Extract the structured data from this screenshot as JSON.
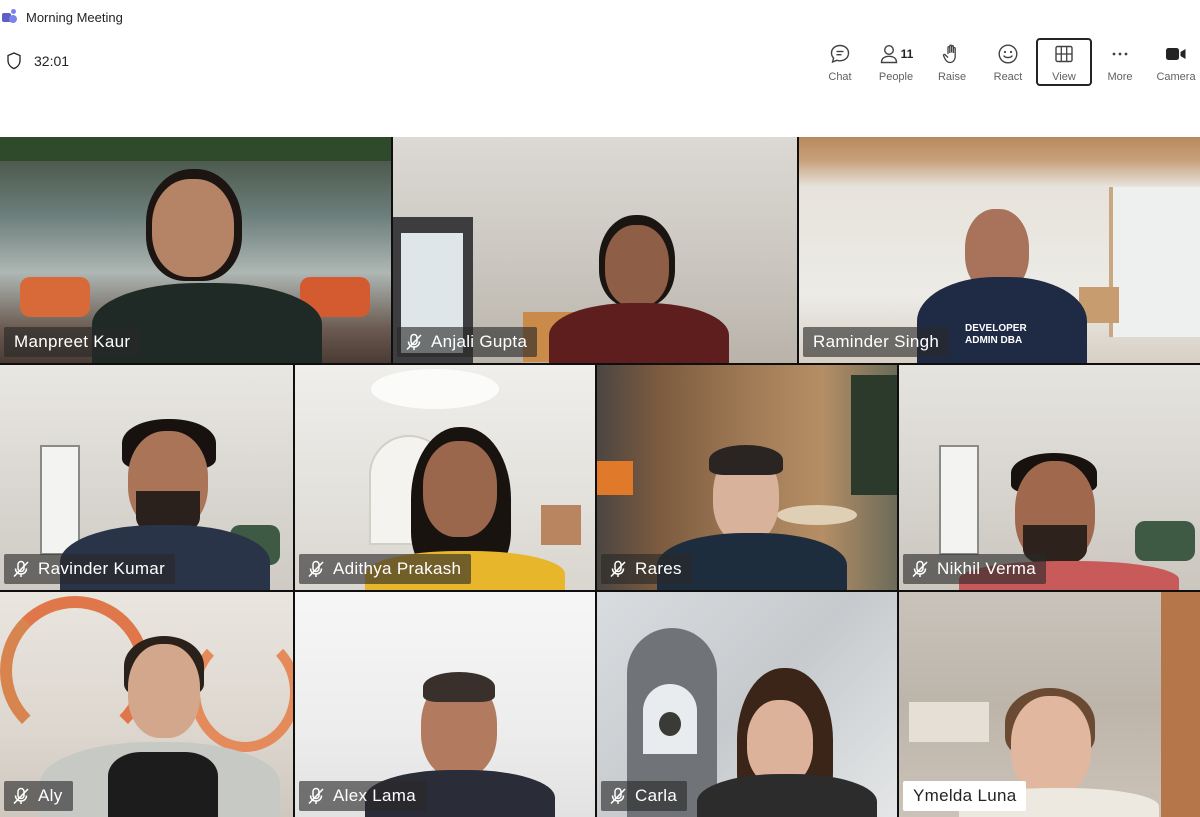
{
  "window": {
    "title": "Morning Meeting",
    "timer": "32:01"
  },
  "toolbar": {
    "chat": "Chat",
    "people": "People",
    "people_count": "11",
    "raise": "Raise",
    "react": "React",
    "view": "View",
    "more": "More",
    "camera": "Camera"
  },
  "participants": [
    {
      "name": "Manpreet Kaur",
      "muted": false
    },
    {
      "name": "Anjali Gupta",
      "muted": true
    },
    {
      "name": "Raminder Singh",
      "muted": false
    },
    {
      "name": "Ravinder Kumar",
      "muted": true
    },
    {
      "name": "Adithya Prakash",
      "muted": true
    },
    {
      "name": "Rares",
      "muted": true
    },
    {
      "name": "Nikhil Verma",
      "muted": true
    },
    {
      "name": "Aly",
      "muted": true
    },
    {
      "name": "Alex Lama",
      "muted": true
    },
    {
      "name": "Carla",
      "muted": true
    },
    {
      "name": "Ymelda Luna",
      "muted": false
    }
  ],
  "shirt_text": "DEVELOPER ADMIN DBA",
  "colors": {
    "accent": "#5b5fc7",
    "name_tag_bg": "#282828",
    "grid_bg": "#0f0f10"
  }
}
